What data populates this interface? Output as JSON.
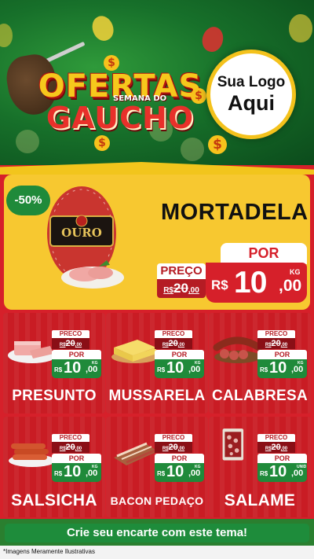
{
  "header": {
    "title_line1": "OFERTAS",
    "title_sub": "SEMANA DO",
    "title_line2": "GAUCHO",
    "logo_line1": "Sua Logo",
    "logo_line2": "Aqui",
    "coin_symbol": "$"
  },
  "featured": {
    "discount": "-50%",
    "brand_label": "OURO",
    "name": "MORTADELA",
    "por_label": "POR",
    "preco_label": "PREÇO",
    "old_currency": "R$",
    "old_price": "20",
    "old_cents": ",00",
    "currency": "R$",
    "price": "10",
    "cents": ",00",
    "unit": "KG"
  },
  "products": [
    {
      "name": "PRESUNTO",
      "preco_label": "PRECO",
      "old_currency": "R$",
      "old_price": "20",
      "old_cents": ",00",
      "por_label": "POR",
      "currency": "R$",
      "price": "10",
      "cents": ",00",
      "unit": "KG"
    },
    {
      "name": "MUSSARELA",
      "preco_label": "PRECO",
      "old_currency": "R$",
      "old_price": "20",
      "old_cents": ",00",
      "por_label": "POR",
      "currency": "R$",
      "price": "10",
      "cents": ",00",
      "unit": "KG"
    },
    {
      "name": "CALABRESA",
      "preco_label": "PRECO",
      "old_currency": "R$",
      "old_price": "20",
      "old_cents": ",00",
      "por_label": "POR",
      "currency": "R$",
      "price": "10",
      "cents": ",00",
      "unit": "KG"
    },
    {
      "name": "SALSICHA",
      "preco_label": "PRECO",
      "old_currency": "R$",
      "old_price": "20",
      "old_cents": ",00",
      "por_label": "POR",
      "currency": "R$",
      "price": "10",
      "cents": ",00",
      "unit": "KG"
    },
    {
      "name": "BACON PEDAÇO",
      "preco_label": "PRECO",
      "old_currency": "R$",
      "old_price": "20",
      "old_cents": ",00",
      "por_label": "POR",
      "currency": "R$",
      "price": "10",
      "cents": ",00",
      "unit": "KG"
    },
    {
      "name": "SALAME",
      "preco_label": "PRECO",
      "old_currency": "R$",
      "old_price": "20",
      "old_cents": ",00",
      "por_label": "POR",
      "currency": "R$",
      "price": "10",
      "cents": ",00",
      "unit": "UNID"
    }
  ],
  "footer": {
    "cta": "Crie seu encarte com este tema!",
    "disclaimer": "*Imagens Meramente Ilustrativas"
  },
  "colors": {
    "header_green": "#17702a",
    "main_red": "#d6202a",
    "accent_yellow": "#f7c830",
    "price_green": "#1f8a3a"
  }
}
